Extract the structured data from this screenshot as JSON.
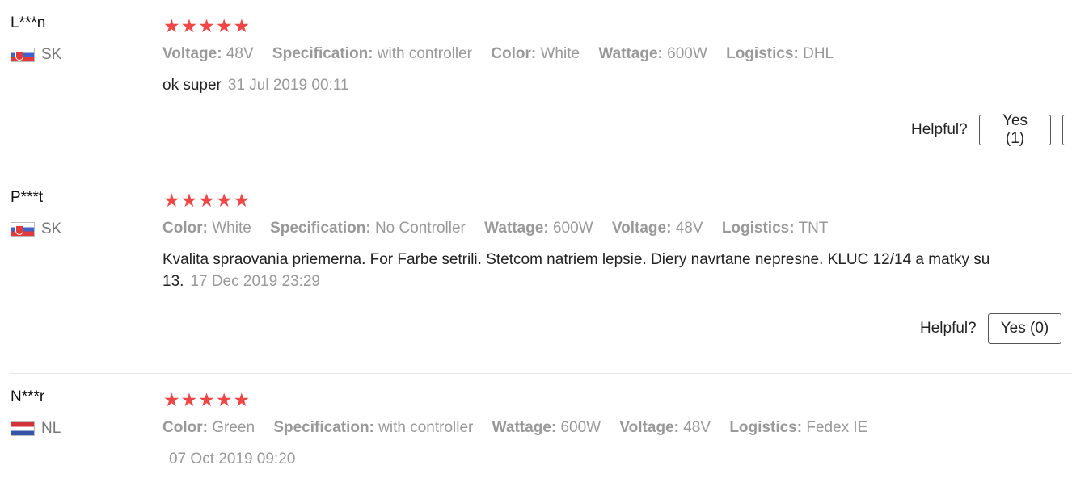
{
  "reviews": [
    {
      "user": "L***n",
      "country": "SK",
      "stars": "★★★★★",
      "attributes": [
        {
          "label": "Voltage:",
          "value": "48V"
        },
        {
          "label": "Specification:",
          "value": "with controller"
        },
        {
          "label": "Color:",
          "value": "White"
        },
        {
          "label": "Wattage:",
          "value": "600W"
        },
        {
          "label": "Logistics:",
          "value": "DHL"
        }
      ],
      "text": "ok super",
      "date": "31 Jul 2019 00:11",
      "helpful_label": "Helpful?",
      "yes_label": "Yes (1)"
    },
    {
      "user": "P***t",
      "country": "SK",
      "stars": "★★★★★",
      "attributes": [
        {
          "label": "Color:",
          "value": "White"
        },
        {
          "label": "Specification:",
          "value": "No Controller"
        },
        {
          "label": "Wattage:",
          "value": "600W"
        },
        {
          "label": "Voltage:",
          "value": "48V"
        },
        {
          "label": "Logistics:",
          "value": "TNT"
        }
      ],
      "text": "Kvalita spraovania priemerna. For Farbe setrili. Stetcom natriem lepsie. Diery navrtane nepresne. KLUC 12/14 a matky su 13.",
      "date": "17 Dec 2019 23:29",
      "helpful_label": "Helpful?",
      "yes_label": "Yes (0)"
    },
    {
      "user": "N***r",
      "country": "NL",
      "stars": "★★★★★",
      "attributes": [
        {
          "label": "Color:",
          "value": "Green"
        },
        {
          "label": "Specification:",
          "value": "with controller"
        },
        {
          "label": "Wattage:",
          "value": "600W"
        },
        {
          "label": "Voltage:",
          "value": "48V"
        },
        {
          "label": "Logistics:",
          "value": "Fedex IE"
        }
      ],
      "text": "",
      "date": "07 Oct 2019 09:20"
    }
  ],
  "colors": {
    "star": "#f04646",
    "muted_text": "#999999",
    "divider": "#e6e6e6"
  }
}
